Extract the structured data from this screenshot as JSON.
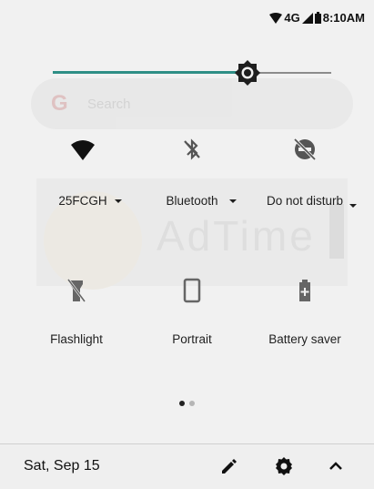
{
  "status_bar": {
    "network": "4G",
    "time": "8:10AM",
    "icons": [
      "wifi-icon",
      "cell-signal-icon",
      "battery-icon"
    ]
  },
  "brightness": {
    "level": 0.7,
    "accent": "#2f8f86"
  },
  "background_ghosts": {
    "search_placeholder": "Search",
    "ad_text": "AdTime"
  },
  "tiles_row1": [
    {
      "icon": "wifi-icon",
      "label": "25FCGH",
      "dropdown": true
    },
    {
      "icon": "bluetooth-off-icon",
      "label": "Bluetooth",
      "dropdown": true
    },
    {
      "icon": "do-not-disturb-icon",
      "label": "Do not disturb",
      "dropdown": true
    }
  ],
  "tiles_row2": [
    {
      "icon": "flashlight-icon",
      "label": "Flashlight"
    },
    {
      "icon": "portrait-icon",
      "label": "Portrait"
    },
    {
      "icon": "battery-saver-icon",
      "label": "Battery saver"
    }
  ],
  "pager": {
    "count": 2,
    "active": 0
  },
  "footer": {
    "date": "Sat, Sep 15",
    "icons": [
      "edit-icon",
      "settings-icon",
      "collapse-icon"
    ]
  }
}
